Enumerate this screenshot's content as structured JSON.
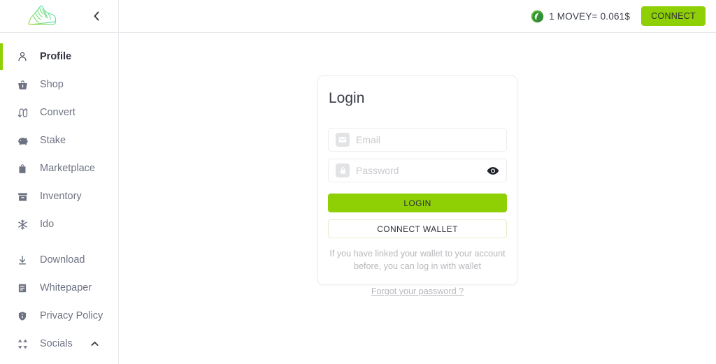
{
  "brand": {
    "logo_icon": "sneaker-logo",
    "accent_color": "#8ed003",
    "collapse_icon": "chevron-left-icon"
  },
  "topbar": {
    "coin_icon": "movey-coin-icon",
    "rate_text": "1 MOVEY= 0.061$",
    "connect_label": "CONNECT"
  },
  "sidebar": {
    "items": [
      {
        "label": "Profile",
        "icon": "user-icon",
        "active": true
      },
      {
        "label": "Shop",
        "icon": "basket-icon",
        "active": false
      },
      {
        "label": "Convert",
        "icon": "swap-arrows-icon",
        "active": false
      },
      {
        "label": "Stake",
        "icon": "piggy-bank-icon",
        "active": false
      },
      {
        "label": "Marketplace",
        "icon": "shopping-bag-icon",
        "active": false
      },
      {
        "label": "Inventory",
        "icon": "box-icon",
        "active": false
      },
      {
        "label": "Ido",
        "icon": "snowflake-icon",
        "active": false
      },
      {
        "label": "Download",
        "icon": "download-icon",
        "active": false
      },
      {
        "label": "Whitepaper",
        "icon": "document-icon",
        "active": false
      },
      {
        "label": "Privacy Policy",
        "icon": "shield-info-icon",
        "active": false
      },
      {
        "label": "Socials",
        "icon": "share-nodes-icon",
        "active": false,
        "caret": "chevron-up-icon"
      }
    ]
  },
  "login": {
    "title": "Login",
    "email": {
      "icon": "envelope-icon",
      "placeholder": "Email",
      "value": ""
    },
    "password": {
      "icon": "lock-icon",
      "placeholder": "Password",
      "value": "",
      "toggle_icon": "eye-icon"
    },
    "login_label": "LOGIN",
    "connect_wallet_label": "CONNECT WALLET",
    "hint": "If you have linked your wallet to your account before, you can log in with wallet",
    "forgot_label": "Forgot your password ?"
  }
}
